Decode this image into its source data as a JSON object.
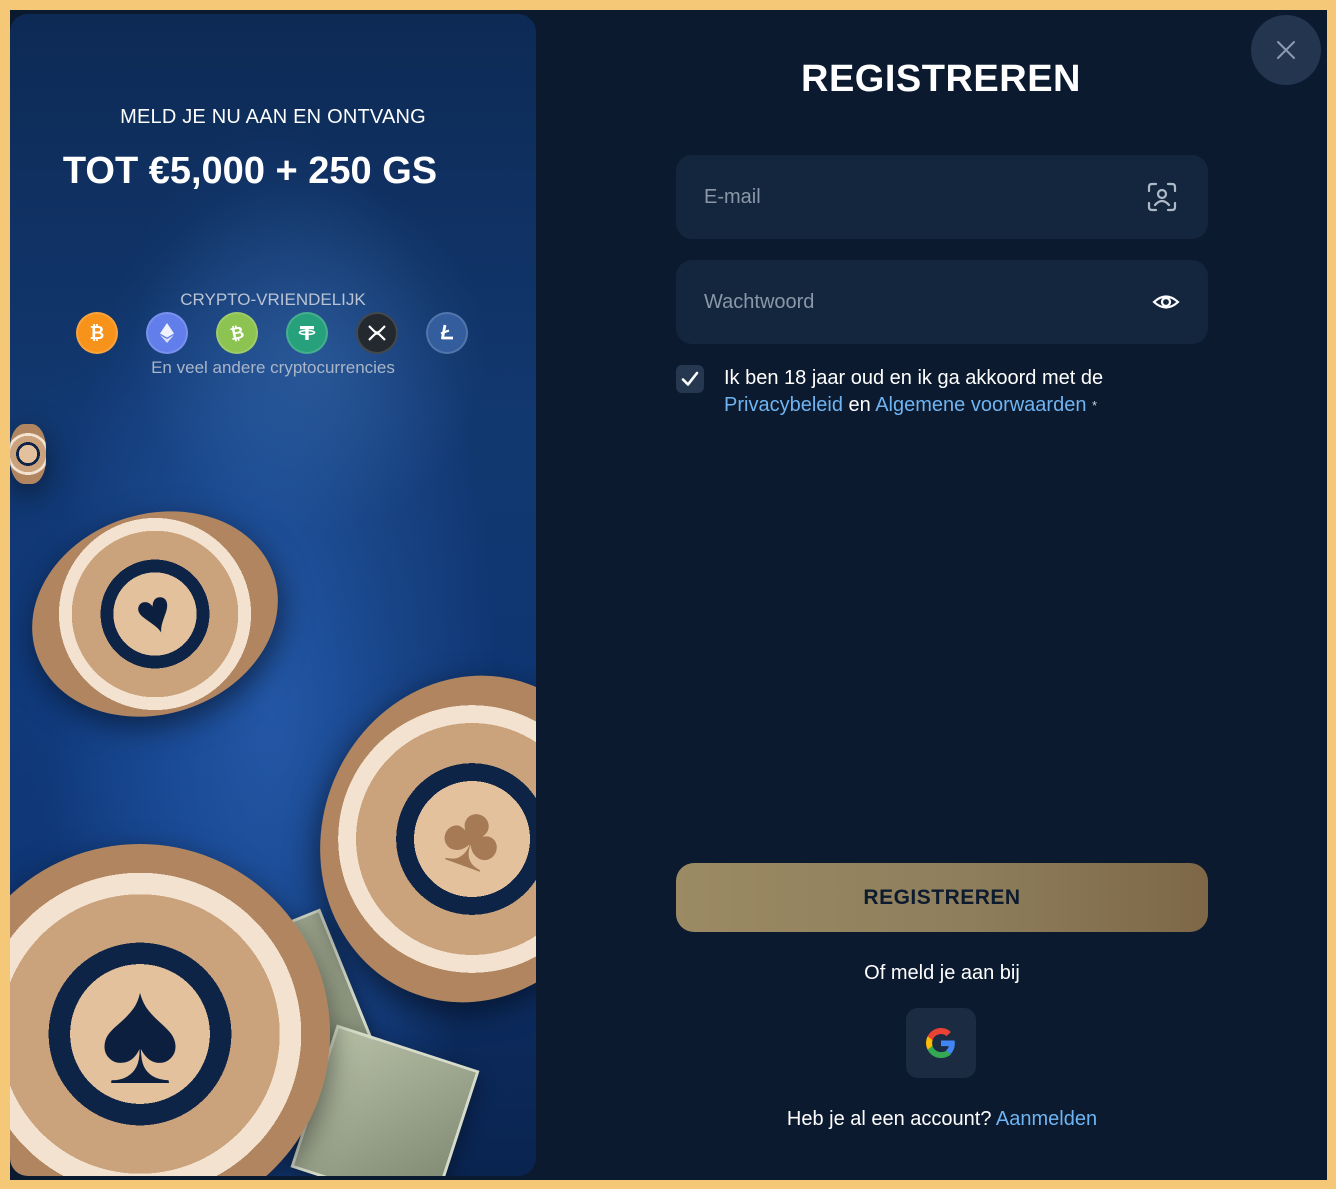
{
  "promo": {
    "subtitle": "MELD JE NU AAN EN ONTVANG",
    "title": "TOT €5,000 + 250 GS",
    "crypto_label": "CRYPTO-VRIENDELIJK",
    "crypto_more": "En veel andere cryptocurrencies",
    "coins": [
      {
        "name": "bitcoin-icon",
        "color": "#f7931a"
      },
      {
        "name": "ethereum-icon",
        "color": "#627eea"
      },
      {
        "name": "bitcoin-cash-icon",
        "color": "#8dc351"
      },
      {
        "name": "tether-icon",
        "color": "#26a17b"
      },
      {
        "name": "xrp-icon",
        "color": "#23292f"
      },
      {
        "name": "litecoin-icon",
        "color": "#345d9d"
      }
    ]
  },
  "form": {
    "title": "REGISTREREN",
    "email_placeholder": "E-mail",
    "password_placeholder": "Wachtwoord",
    "consent_prefix": "Ik ben 18 jaar oud en ik ga akkoord met de",
    "privacy_link": "Privacybeleid",
    "consent_and": "en",
    "terms_link": "Algemene voorwaarden",
    "required_mark": "*",
    "submit_label": "REGISTREREN",
    "or_text": "Of meld je aan bij",
    "login_prompt": "Heb je al een account?",
    "login_link": "Aanmelden",
    "consent_checked": true
  },
  "colors": {
    "frame": "#f4c877",
    "background": "#0b1a2e",
    "field": "#14263d",
    "link": "#6fb4f2",
    "button_gold": "#9b8a63"
  }
}
